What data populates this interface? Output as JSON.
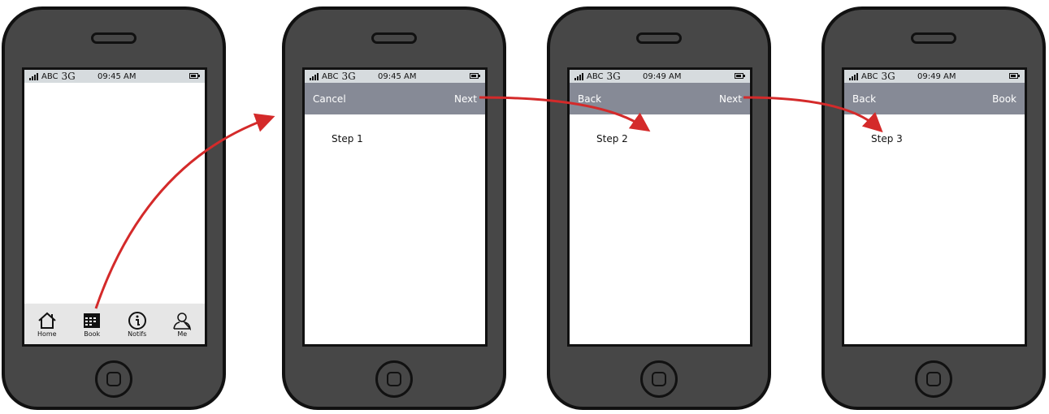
{
  "status_bar": {
    "carrier": "ABC",
    "network": "3G",
    "times": [
      "09:45 AM",
      "09:45 AM",
      "09:49 AM",
      "09:49 AM"
    ]
  },
  "screen1": {
    "tabs": [
      {
        "label": "Home",
        "icon": "home-icon"
      },
      {
        "label": "Book",
        "icon": "calendar-icon"
      },
      {
        "label": "Notifs",
        "icon": "info-icon"
      },
      {
        "label": "Me",
        "icon": "user-icon"
      }
    ]
  },
  "screen2": {
    "left": "Cancel",
    "right": "Next",
    "content": "Step 1"
  },
  "screen3": {
    "left": "Back",
    "right": "Next",
    "content": "Step 2"
  },
  "screen4": {
    "left": "Back",
    "right": "Book",
    "content": "Step 3"
  },
  "colors": {
    "arrow": "#d42a2a",
    "navbar": "#868a96",
    "phone": "#474747"
  }
}
